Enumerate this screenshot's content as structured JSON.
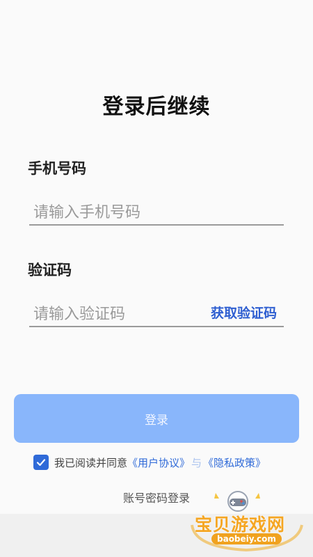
{
  "title": "登录后继续",
  "phone": {
    "label": "手机号码",
    "placeholder": "请输入手机号码"
  },
  "code": {
    "label": "验证码",
    "placeholder": "请输入验证码",
    "get_code": "获取验证码"
  },
  "login_button": "登录",
  "agreement": {
    "checked": true,
    "prefix": "我已阅读并同意",
    "user_agreement": "《用户协议》",
    "separator": "与",
    "privacy_policy": "《隐私政策》"
  },
  "alt_login": "账号密码登录",
  "watermark": {
    "text": "宝贝游戏网",
    "domain": "baobeiy.com"
  },
  "colors": {
    "accent": "#2f6ad8",
    "button": "#89b6fb",
    "watermark": "#f5a623"
  }
}
